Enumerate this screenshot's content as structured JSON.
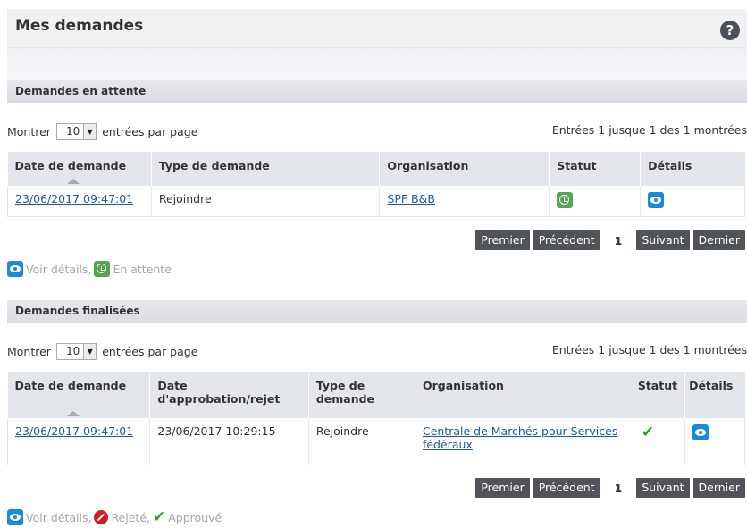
{
  "page": {
    "title": "Mes demandes"
  },
  "help": {
    "icon": "?"
  },
  "pending": {
    "title": "Demandes en attente",
    "show_prefix": "Montrer",
    "show_value": "10",
    "show_suffix": "entrées par page",
    "info": "Entrées 1 jusque 1 des 1 montrées",
    "columns": [
      "Date de demande",
      "Type de demande",
      "Organisation",
      "Statut",
      "Détails"
    ],
    "rows": [
      {
        "date": "23/06/2017 09:47:01",
        "type": "Rejoindre",
        "organisation": "SPF B&B",
        "status_icon": "clock-icon",
        "details_icon": "eye-icon"
      }
    ],
    "pager": {
      "first": "Premier",
      "prev": "Précédent",
      "current": "1",
      "next": "Suivant",
      "last": "Dernier"
    },
    "legend": {
      "details": "Voir détails,",
      "pending": "En attente"
    }
  },
  "finalized": {
    "title": "Demandes finalisées",
    "show_prefix": "Montrer",
    "show_value": "10",
    "show_suffix": "entrées par page",
    "info": "Entrées 1 jusque 1 des 1 montrées",
    "columns": [
      "Date de demande",
      "Date d'approbation/rejet",
      "Type de demande",
      "Organisation",
      "Statut",
      "Détails"
    ],
    "rows": [
      {
        "date": "23/06/2017 09:47:01",
        "decision_date": "23/06/2017 10:29:15",
        "type": "Rejoindre",
        "organisation": "Centrale de Marchés pour Services fédéraux",
        "status_icon": "check-icon",
        "details_icon": "eye-icon"
      }
    ],
    "pager": {
      "first": "Premier",
      "prev": "Précédent",
      "current": "1",
      "next": "Suivant",
      "last": "Dernier"
    },
    "legend": {
      "details": "Voir détails,",
      "rejected": "Rejeté,",
      "approved": "Approuvé"
    }
  },
  "colors": {
    "link": "#1a5aa8",
    "pager_button": "#505459",
    "pending_status": "#55a455",
    "approved": "#3c9a2a",
    "rejected": "#cc1f1f",
    "details_icon": "#1b8ad9"
  }
}
